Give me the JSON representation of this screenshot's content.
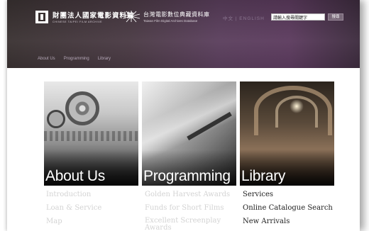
{
  "colors": {
    "header_start": "#3a3232",
    "header_mid": "#5b3f5d",
    "muted_link": "#d3d3d3",
    "active_link": "#222222",
    "nav_text": "#b5a8b8"
  },
  "header": {
    "logo1": {
      "icon": "film-frame-icon",
      "chinese": "財團法人國家電影資料館",
      "english": "CHINESE TAIPEI FILM ARCHIVE"
    },
    "logo2": {
      "icon": "starburst-logo-icon",
      "chinese": "台灣電影數位典藏資料庫",
      "english": "Taiwan Film Digital Archives Database"
    },
    "language_switch": "中文 | ENGLISH",
    "search": {
      "value": "請輸入搜尋關鍵字",
      "button": "搜尋"
    },
    "nav": [
      "About Us",
      "Programming",
      "Library"
    ]
  },
  "sections": [
    {
      "heading": "About Us",
      "links": [
        "Introduction",
        "Loan & Service",
        "Map"
      ]
    },
    {
      "heading": "Programming",
      "links": [
        "Golden Harvest Awards",
        "Funds for Short Films",
        "Excellent Screenplay Awards"
      ]
    },
    {
      "heading": "Library",
      "links": [
        "Services",
        "Online Catalogue Search",
        "New Arrivals"
      ]
    }
  ]
}
